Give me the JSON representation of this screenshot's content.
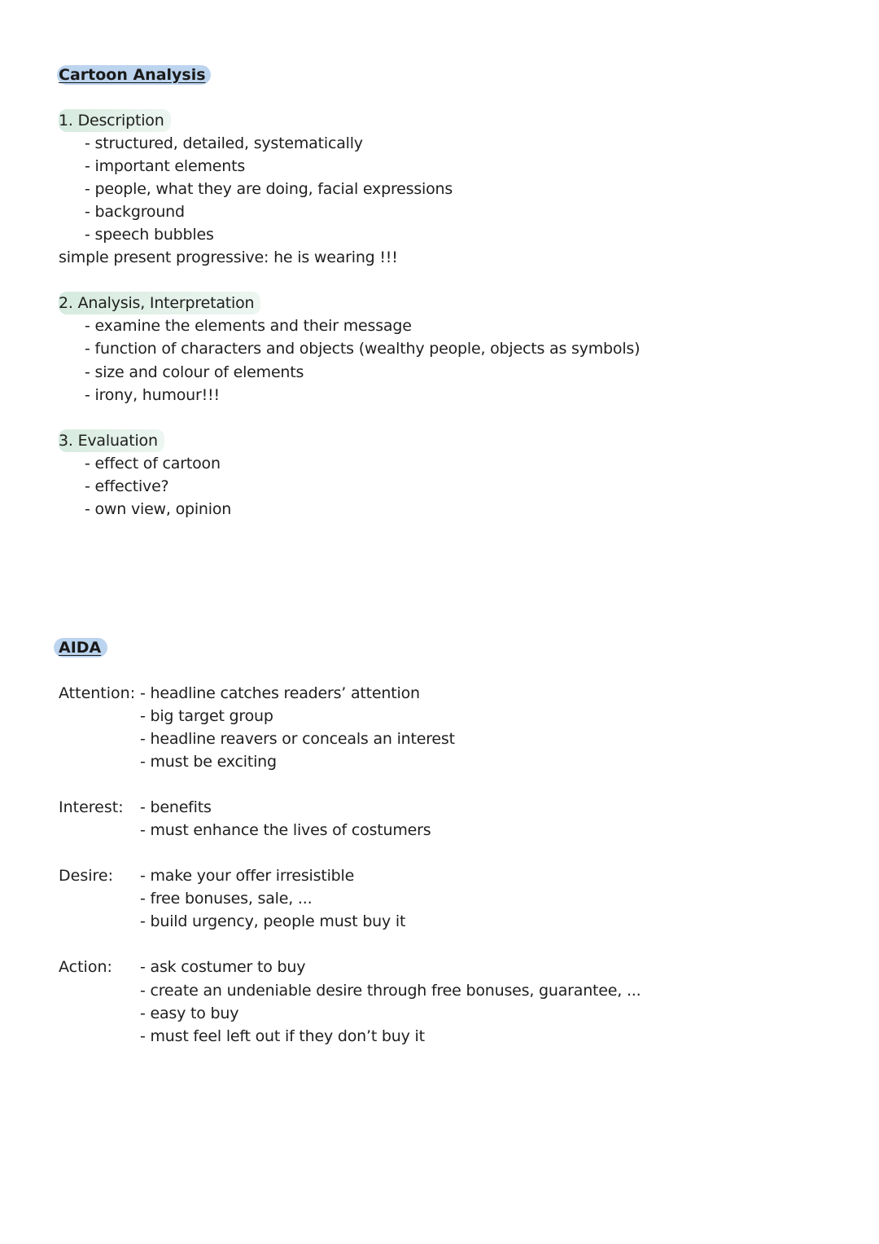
{
  "cartoon": {
    "title": "Cartoon Analysis",
    "sections": [
      {
        "heading": "1. Description",
        "items": [
          "- structured, detailed, systematically",
          "- important elements",
          "- people, what they are doing, facial expressions",
          "- background",
          "- speech bubbles"
        ],
        "note": "simple present progressive: he is wearing !!!"
      },
      {
        "heading": "2. Analysis, Interpretation",
        "items": [
          "- examine the elements and their message",
          "- function of characters and objects (wealthy people, objects as symbols)",
          "- size and colour of elements",
          "- irony, humour!!!"
        ]
      },
      {
        "heading": "3. Evaluation",
        "items": [
          "- effect of cartoon",
          "- effective?",
          "- own view, opinion"
        ]
      }
    ]
  },
  "aida": {
    "title": "AIDA",
    "groups": [
      {
        "label": "Attention:",
        "items": [
          "- headline catches readers’ attention",
          "- big target group",
          "- headline reavers or conceals an interest",
          "- must be exciting"
        ]
      },
      {
        "label": "Interest:",
        "items": [
          "- benefits",
          "- must enhance the lives of costumers"
        ]
      },
      {
        "label": "Desire:",
        "items": [
          "- make your offer irresistible",
          "- free bonuses, sale, ...",
          "- build urgency, people must buy it"
        ]
      },
      {
        "label": "Action:",
        "items": [
          "- ask costumer to buy",
          "- create an undeniable desire through free bonuses, guarantee, ...",
          "- easy to buy",
          "- must feel left out if they don’t buy it"
        ]
      }
    ]
  }
}
